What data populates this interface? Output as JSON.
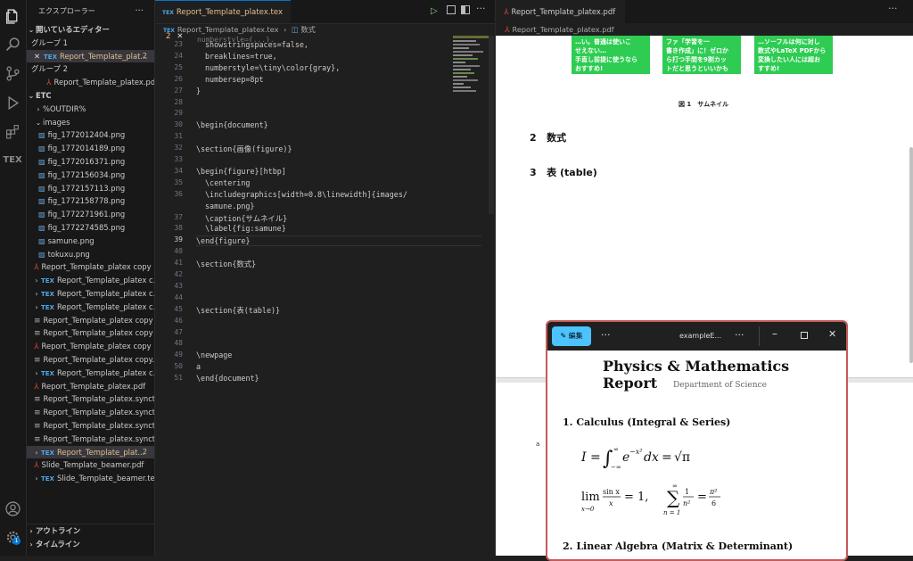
{
  "sidebar": {
    "title": "エクスプローラー",
    "open_editors": "開いているエディター",
    "group1": "グループ 1",
    "group1_file": "Report_Template_plat...",
    "group1_badge": "2",
    "group2": "グループ 2",
    "group2_file": "Report_Template_platex.pdf",
    "root": "ETC",
    "folders": [
      "%OUTDIR%",
      "images"
    ],
    "images": [
      "fig_1772012404.png",
      "fig_1772014189.png",
      "fig_1772016371.png",
      "fig_1772156034.png",
      "fig_1772157113.png",
      "fig_1772158778.png",
      "fig_1772271961.png",
      "fig_1772274585.png",
      "samune.png",
      "tokuxu.png"
    ],
    "files": [
      {
        "name": "Report_Template_platex copy ...",
        "type": "pdf"
      },
      {
        "name": "Report_Template_platex c...",
        "type": "tex",
        "twisty": true
      },
      {
        "name": "Report_Template_platex c...",
        "type": "tex",
        "twisty": true
      },
      {
        "name": "Report_Template_platex c...",
        "type": "tex",
        "twisty": true
      },
      {
        "name": "Report_Template_platex copy ...",
        "type": "txt"
      },
      {
        "name": "Report_Template_platex copy ...",
        "type": "txt"
      },
      {
        "name": "Report_Template_platex copy ...",
        "type": "pdf"
      },
      {
        "name": "Report_Template_platex copy...",
        "type": "txt"
      },
      {
        "name": "Report_Template_platex c...",
        "type": "tex",
        "twisty": true
      },
      {
        "name": "Report_Template_platex.pdf",
        "type": "pdf"
      },
      {
        "name": "Report_Template_platex.synct...",
        "type": "txt"
      },
      {
        "name": "Report_Template_platex.synct...",
        "type": "txt"
      },
      {
        "name": "Report_Template_platex.synct...",
        "type": "txt"
      },
      {
        "name": "Report_Template_platex.synct...",
        "type": "txt"
      },
      {
        "name": "Report_Template_plat...",
        "type": "tex",
        "twisty": true,
        "badge": "2",
        "selected": true
      },
      {
        "name": "Slide_Template_beamer.pdf",
        "type": "pdf"
      },
      {
        "name": "Slide_Template_beamer.tex",
        "type": "tex",
        "twisty": true
      }
    ],
    "outline": "アウトライン",
    "timeline": "タイムライン"
  },
  "editor": {
    "tab_label": "Report_Template_platex.tex",
    "tab_badge": "2",
    "breadcrumb_file": "Report_Template_platex.tex",
    "breadcrumb_section": "数式",
    "lines": [
      {
        "n": "23",
        "text": "showstringspaces=false,"
      },
      {
        "n": "24",
        "text": "breaklines=true,"
      },
      {
        "n": "25",
        "text": "numberstyle=\\tiny\\color{gray},"
      },
      {
        "n": "26",
        "text": "numbersep=8pt"
      },
      {
        "n": "27",
        "text": "}"
      },
      {
        "n": "28",
        "text": ""
      },
      {
        "n": "29",
        "text": ""
      },
      {
        "n": "30",
        "text": "\\begin{document}"
      },
      {
        "n": "31",
        "text": ""
      },
      {
        "n": "32",
        "text": "\\section{画像(figure)}"
      },
      {
        "n": "33",
        "text": ""
      },
      {
        "n": "34",
        "text": "\\begin{figure}[htbp]"
      },
      {
        "n": "35",
        "text": "\\centering"
      },
      {
        "n": "36",
        "text": "\\includegraphics[width=0.8\\linewidth]{images/"
      },
      {
        "n": "",
        "text": "samune.png}"
      },
      {
        "n": "37",
        "text": "\\caption{サムネイル}"
      },
      {
        "n": "38",
        "text": "\\label{fig:samune}"
      },
      {
        "n": "39",
        "text": "\\end{figure}"
      },
      {
        "n": "40",
        "text": ""
      },
      {
        "n": "41",
        "text": "\\section{数式}"
      },
      {
        "n": "42",
        "text": ""
      },
      {
        "n": "43",
        "text": ""
      },
      {
        "n": "44",
        "text": ""
      },
      {
        "n": "45",
        "text": "\\section{表(table)}"
      },
      {
        "n": "46",
        "text": ""
      },
      {
        "n": "47",
        "text": ""
      },
      {
        "n": "48",
        "text": ""
      },
      {
        "n": "49",
        "text": "\\newpage"
      },
      {
        "n": "50",
        "text": "a"
      },
      {
        "n": "51",
        "text": "\\end{document}"
      }
    ]
  },
  "pdf": {
    "tab_label": "Report_Template_platex.pdf",
    "breadcrumb": "Report_Template_platex.pdf",
    "thumbs": [
      [
        "…い。普通は使いこ",
        "せえない…",
        "手直し前提に使うなら",
        "おすすめ!"
      ],
      [
        "ファ「学習を一",
        "書き作成」に！ゼロか",
        "ら打つ手間を9割カッ",
        "トだと思うといいかも"
      ],
      [
        "…ソーフルは何に対し",
        "数式やLaTeX PDFから",
        "変換したい人には超お",
        "すすめ!"
      ]
    ],
    "fig_caption": "図 1　サムネイル",
    "sections": [
      {
        "num": "2",
        "title": "数式"
      },
      {
        "num": "3",
        "title": "表 (table)"
      }
    ],
    "page2_mark": "a"
  },
  "popup": {
    "edit_label": "編集",
    "title": "exampleE...",
    "doc_title": "Physics & Mathematics Report",
    "doc_subtitle": "Department of Science",
    "section1": "1. Calculus (Integral & Series)",
    "section2": "2. Linear Algebra (Matrix & Determinant)"
  }
}
